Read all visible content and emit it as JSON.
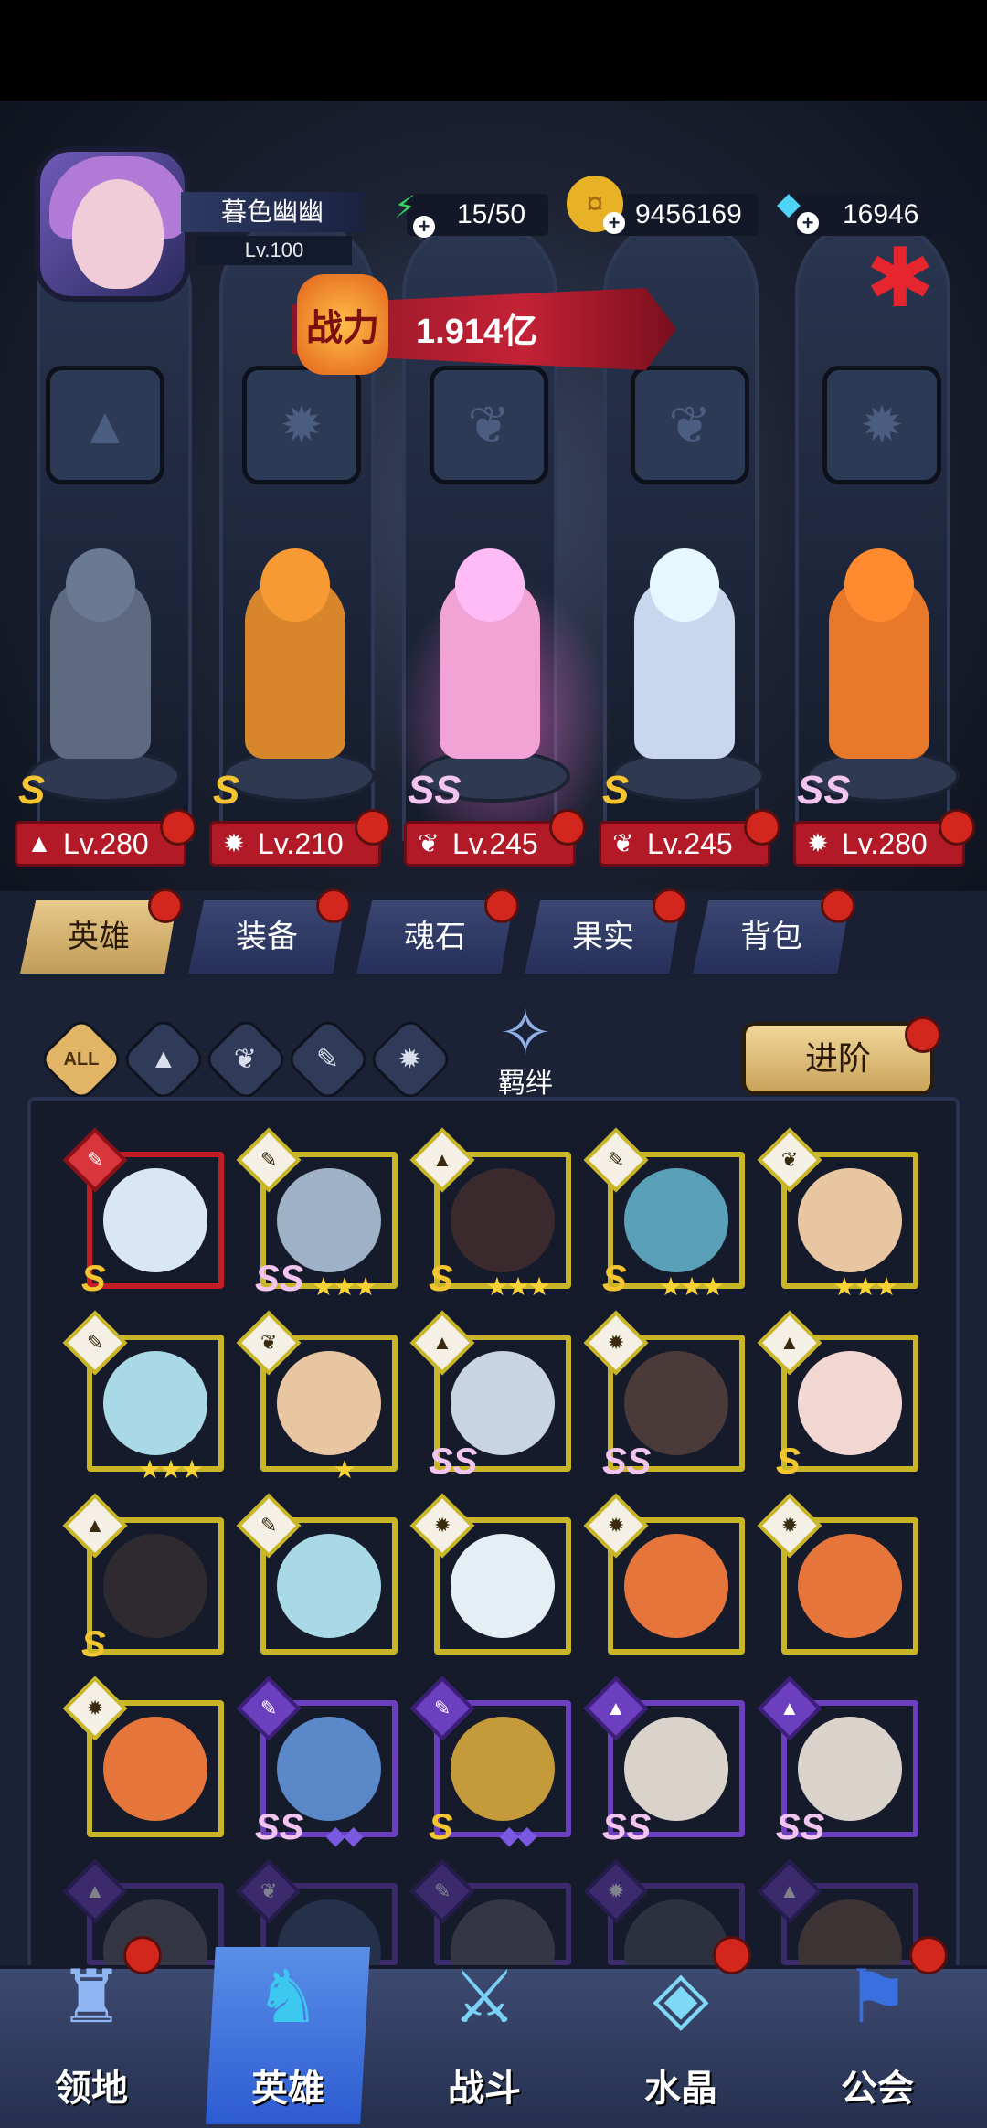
{
  "player": {
    "name": "暮色幽幽",
    "level": "Lv.100"
  },
  "resources": {
    "energy": "15/50",
    "gold": "9456169",
    "diamond": "16946"
  },
  "power": {
    "badge": "战力",
    "value": "1.914亿"
  },
  "lineup": [
    {
      "rank": "S",
      "level": "Lv.280",
      "class_icon": "assassin-icon",
      "color": "#5d6a80"
    },
    {
      "rank": "S",
      "level": "Lv.210",
      "class_icon": "beast-icon",
      "color": "#d8862c"
    },
    {
      "rank": "SS",
      "level": "Lv.245",
      "class_icon": "wing-icon",
      "color": "#f2a3d5"
    },
    {
      "rank": "S",
      "level": "Lv.245",
      "class_icon": "wing-icon",
      "color": "#c9d7ee"
    },
    {
      "rank": "SS",
      "level": "Lv.280",
      "class_icon": "beast-icon",
      "color": "#e8782a"
    }
  ],
  "tabs": [
    {
      "label": "英雄",
      "active": true
    },
    {
      "label": "装备",
      "active": false
    },
    {
      "label": "魂石",
      "active": false
    },
    {
      "label": "果实",
      "active": false
    },
    {
      "label": "背包",
      "active": false
    }
  ],
  "filters": {
    "all": "ALL",
    "bond": "羁绊",
    "advance": "进阶"
  },
  "roster": [
    {
      "frame": "red",
      "cls": "wrench-icon",
      "rank": "S",
      "stars": "",
      "portrait": "#d9e7f5"
    },
    {
      "frame": "gold",
      "cls": "wrench-icon",
      "rank": "SS",
      "stars": "★★★",
      "portrait": "#9fb1c6"
    },
    {
      "frame": "gold",
      "cls": "assassin-icon",
      "rank": "S",
      "stars": "★★★",
      "portrait": "#3a2a2e"
    },
    {
      "frame": "gold",
      "cls": "wrench-icon",
      "rank": "S",
      "stars": "★★★",
      "portrait": "#5aa0b8"
    },
    {
      "frame": "gold",
      "cls": "wing-icon",
      "rank": "",
      "stars": "★★★",
      "portrait": "#e9c6a2"
    },
    {
      "frame": "gold",
      "cls": "wrench-icon",
      "rank": "",
      "stars": "★★★",
      "portrait": "#a9d8e6"
    },
    {
      "frame": "gold",
      "cls": "wing-icon",
      "rank": "",
      "stars": "★",
      "portrait": "#e9c6a2"
    },
    {
      "frame": "gold",
      "cls": "assassin-icon",
      "rank": "SS",
      "stars": "",
      "portrait": "#c9d4e2"
    },
    {
      "frame": "gold",
      "cls": "beast-icon",
      "rank": "SS",
      "stars": "",
      "portrait": "#4a3a3a"
    },
    {
      "frame": "gold",
      "cls": "assassin-icon",
      "rank": "S",
      "stars": "",
      "portrait": "#f1d6d2"
    },
    {
      "frame": "gold",
      "cls": "assassin-icon",
      "rank": "S",
      "stars": "",
      "portrait": "#2e2a30"
    },
    {
      "frame": "gold",
      "cls": "wrench-icon",
      "rank": "",
      "stars": "",
      "portrait": "#a9d8e6"
    },
    {
      "frame": "gold",
      "cls": "beast-icon",
      "rank": "",
      "stars": "",
      "portrait": "#e6eef5"
    },
    {
      "frame": "gold",
      "cls": "beast-icon",
      "rank": "",
      "stars": "",
      "portrait": "#e5753a"
    },
    {
      "frame": "gold",
      "cls": "beast-icon",
      "rank": "",
      "stars": "",
      "portrait": "#e5753a"
    },
    {
      "frame": "gold",
      "cls": "beast-icon",
      "rank": "",
      "stars": "",
      "portrait": "#e5753a"
    },
    {
      "frame": "purple",
      "cls": "wrench-icon",
      "rank": "SS",
      "stars": "◆◆",
      "portrait": "#5b88c8"
    },
    {
      "frame": "purple",
      "cls": "wrench-icon",
      "rank": "S",
      "stars": "◆◆",
      "portrait": "#c49a3a"
    },
    {
      "frame": "purple",
      "cls": "assassin-icon",
      "rank": "SS",
      "stars": "",
      "portrait": "#dad3cc"
    },
    {
      "frame": "purple",
      "cls": "assassin-icon",
      "rank": "SS",
      "stars": "",
      "portrait": "#dad3cc"
    },
    {
      "frame": "purple",
      "cls": "assassin-icon",
      "rank": "",
      "stars": "",
      "portrait": "#5a5a60"
    },
    {
      "frame": "purple",
      "cls": "wing-icon",
      "rank": "",
      "stars": "",
      "portrait": "#3a4a70"
    },
    {
      "frame": "purple",
      "cls": "wrench-icon",
      "rank": "",
      "stars": "",
      "portrait": "#5a5a60"
    },
    {
      "frame": "purple",
      "cls": "beast-icon",
      "rank": "",
      "stars": "",
      "portrait": "#4a4a55"
    },
    {
      "frame": "purple",
      "cls": "assassin-icon",
      "rank": "",
      "stars": "",
      "portrait": "#6a5040"
    }
  ],
  "nav": [
    {
      "label": "领地",
      "icon": "castle-icon",
      "active": false
    },
    {
      "label": "英雄",
      "icon": "hero-icon",
      "active": true
    },
    {
      "label": "战斗",
      "icon": "sword-icon",
      "active": false
    },
    {
      "label": "水晶",
      "icon": "crystal-icon",
      "active": false
    },
    {
      "label": "公会",
      "icon": "banner-icon",
      "active": false
    }
  ]
}
